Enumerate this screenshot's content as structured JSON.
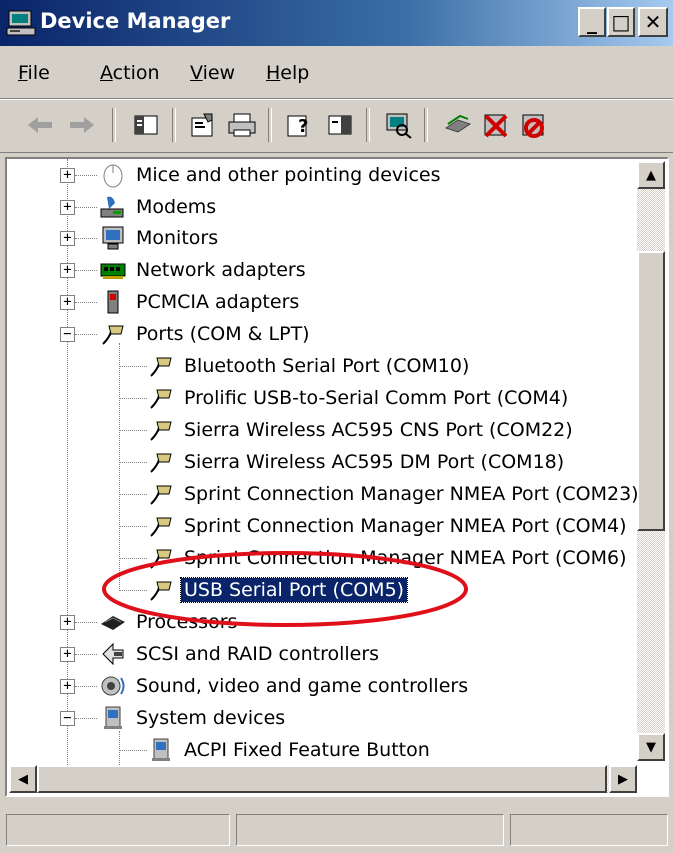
{
  "window": {
    "title": "Device Manager",
    "buttons": {
      "minimize": "_",
      "maximize": "□",
      "close": "✕"
    }
  },
  "menu": [
    {
      "label": "File",
      "accel": "F",
      "rest": "ile"
    },
    {
      "label": "Action",
      "accel": "A",
      "rest": "ction"
    },
    {
      "label": "View",
      "accel": "V",
      "rest": "iew"
    },
    {
      "label": "Help",
      "accel": "H",
      "rest": "elp"
    }
  ],
  "toolbar": {
    "icons": [
      "back-icon",
      "forward-icon",
      "show-hide-console-tree-icon",
      "properties-icon",
      "print-icon",
      "help-icon",
      "show-hide-action-pane-icon",
      "scan-hardware-changes-icon",
      "update-driver-icon",
      "uninstall-icon",
      "disable-icon"
    ]
  },
  "tree": {
    "categories": [
      {
        "label": "Mice and other pointing devices",
        "expanded": false,
        "icon": "mouse-icon"
      },
      {
        "label": "Modems",
        "expanded": false,
        "icon": "modem-icon"
      },
      {
        "label": "Monitors",
        "expanded": false,
        "icon": "monitor-icon"
      },
      {
        "label": "Network adapters",
        "expanded": false,
        "icon": "network-adapter-icon"
      },
      {
        "label": "PCMCIA adapters",
        "expanded": false,
        "icon": "pcmcia-icon"
      },
      {
        "label": "Ports (COM & LPT)",
        "expanded": true,
        "icon": "port-icon"
      },
      {
        "label": "Processors",
        "expanded": false,
        "icon": "processor-icon"
      },
      {
        "label": "SCSI and RAID controllers",
        "expanded": false,
        "icon": "scsi-icon"
      },
      {
        "label": "Sound, video and game controllers",
        "expanded": false,
        "icon": "sound-icon"
      },
      {
        "label": "System devices",
        "expanded": true,
        "icon": "system-device-icon"
      }
    ],
    "ports": [
      "Bluetooth Serial Port (COM10)",
      "Prolific USB-to-Serial Comm Port (COM4)",
      "Sierra Wireless AC595 CNS Port (COM22)",
      "Sierra Wireless AC595 DM Port (COM18)",
      "Sprint Connection Manager NMEA Port (COM23)",
      "Sprint Connection Manager NMEA Port (COM4)",
      "Sprint Connection Manager NMEA Port (COM6)",
      "USB Serial Port (COM5)"
    ],
    "selected": "USB Serial Port (COM5)",
    "system_devices": [
      "ACPI Fixed Feature Button"
    ]
  },
  "colors": {
    "title_gradient_start": "#0a246a",
    "title_gradient_end": "#a6caf0",
    "selection": "#0a246a",
    "annotation": "#e0101a",
    "face": "#d4d0c8"
  },
  "statusbar": {
    "panels": [
      "",
      "",
      ""
    ]
  }
}
